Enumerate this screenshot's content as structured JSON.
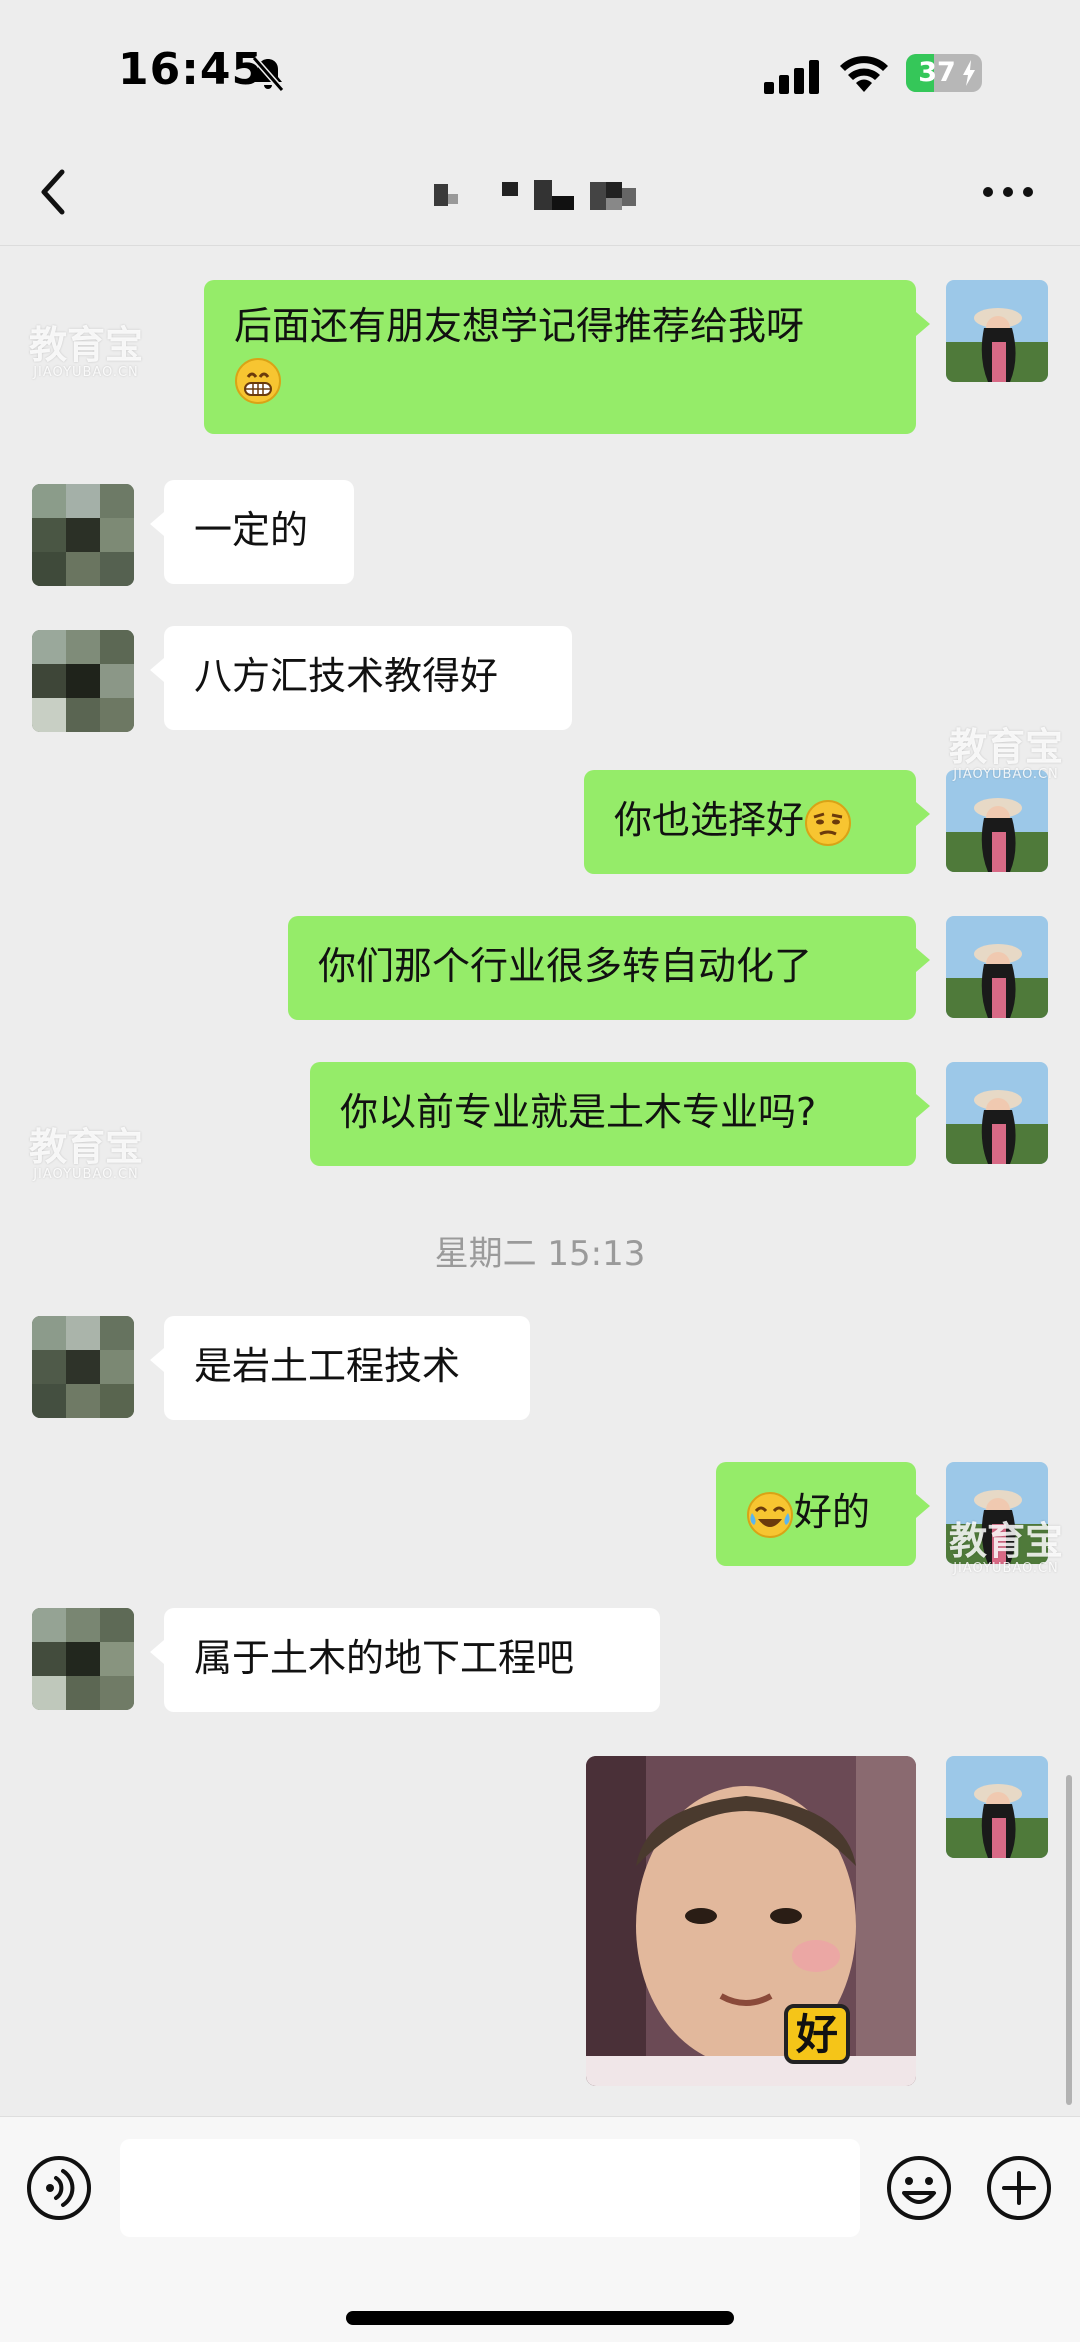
{
  "status_bar": {
    "time": "16:45",
    "battery_level": "37",
    "battery_percent": 37
  },
  "nav": {
    "title": "",
    "title_pixelated": true
  },
  "colors": {
    "background": "#ededed",
    "outgoing_bubble": "#95ec69",
    "incoming_bubble": "#ffffff",
    "battery_green": "#35c759"
  },
  "icons": {
    "back": "chevron-left-icon",
    "more": "more-dots-icon",
    "voice": "voice-icon",
    "emoji": "smiley-icon",
    "plus": "plus-icon",
    "bell_off": "bell-slash-icon",
    "signal": "signal-icon",
    "wifi": "wifi-icon"
  },
  "messages": [
    {
      "side": "out",
      "text": "后面还有朋友想学记得推荐给我呀",
      "emoji": "grin-emoji"
    },
    {
      "side": "in",
      "text": "一定的"
    },
    {
      "side": "in",
      "text": "八方汇技术教得好"
    },
    {
      "side": "out",
      "text": "你也选择好",
      "emoji": "skeptical-emoji"
    },
    {
      "side": "out",
      "text": "你们那个行业很多转自动化了"
    },
    {
      "side": "out",
      "text": "你以前专业就是土木专业吗?"
    },
    {
      "side": "in",
      "text": "是岩土工程技术"
    },
    {
      "side": "out",
      "text": "好的",
      "emoji": "tears-of-joy-emoji"
    },
    {
      "side": "in",
      "text": "属于土木的地下工程吧"
    },
    {
      "side": "out",
      "sticker": "child-sticker",
      "sticker_caption": "好"
    }
  ],
  "timestamp": "星期二 15:13",
  "watermark": {
    "main": "教育宝",
    "sub": "JIAOYUBAO.CN"
  },
  "input": {
    "value": "",
    "placeholder": ""
  }
}
